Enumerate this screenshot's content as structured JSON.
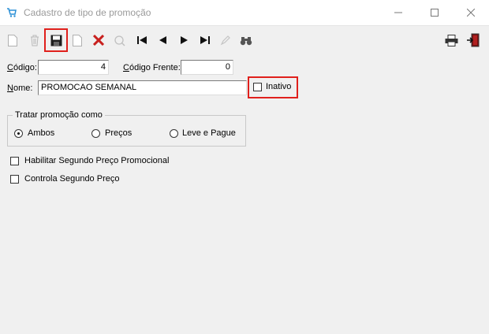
{
  "window": {
    "title": "Cadastro de tipo de promoção",
    "controls": {
      "minimize": "minimize-icon",
      "maximize": "maximize-icon",
      "close": "close-icon"
    }
  },
  "toolbar": {
    "buttons": [
      "new-document-icon",
      "delete-icon",
      "save-icon",
      "copy-document-icon",
      "cancel-icon",
      "search-icon",
      "first-record-icon",
      "previous-record-icon",
      "next-record-icon",
      "last-record-icon",
      "edit-icon",
      "binoculars-icon",
      "printer-icon",
      "exit-icon"
    ],
    "highlight_color": "#e0201c"
  },
  "form": {
    "codigo_label_u": "C",
    "codigo_label_rest": "ódigo:",
    "codigo_value": "4",
    "codigo_frente_label_u": "C",
    "codigo_frente_label_rest": "ódigo Frente:",
    "codigo_frente_value": "0",
    "nome_label_u": "N",
    "nome_label_rest": "ome:",
    "nome_value": "PROMOCAO SEMANAL",
    "inativo_label": "Inativo",
    "inativo_checked": false
  },
  "tratar": {
    "title": "Tratar promoção como",
    "options": [
      {
        "label": "Ambos",
        "selected": true
      },
      {
        "label": "Preços",
        "selected": false
      },
      {
        "label": "Leve e Pague",
        "selected": false
      }
    ]
  },
  "options": {
    "habilitar_label": "Habilitar Segundo Preço Promocional",
    "habilitar_checked": false,
    "controla_label": "Controla Segundo Preço",
    "controla_checked": false
  }
}
